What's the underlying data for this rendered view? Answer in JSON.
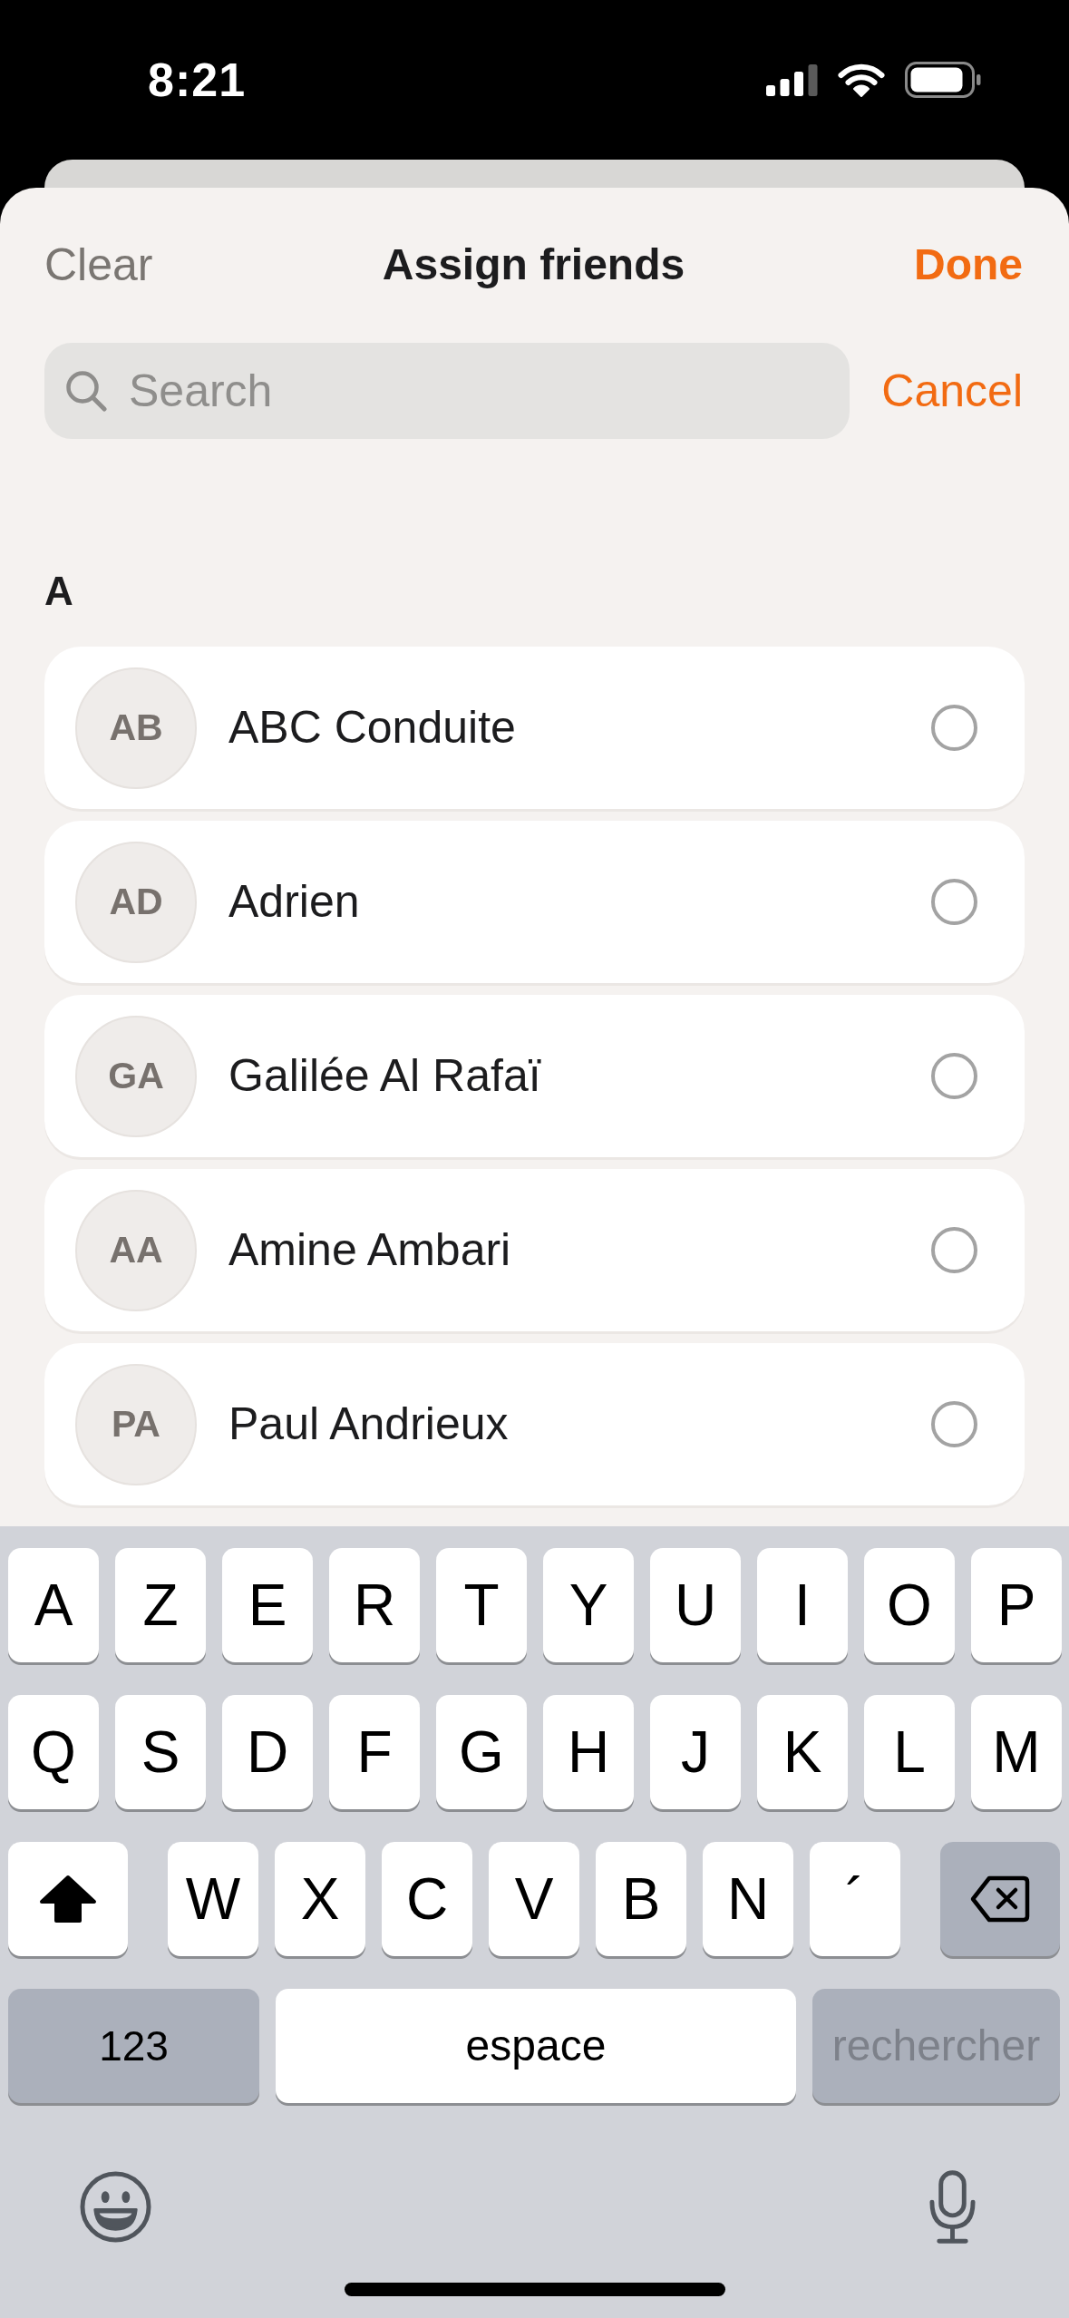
{
  "status_bar": {
    "time": "8:21"
  },
  "header": {
    "clear": "Clear",
    "title": "Assign friends",
    "done": "Done"
  },
  "search": {
    "placeholder": "Search",
    "cancel": "Cancel"
  },
  "sections": [
    {
      "letter": "A",
      "friends": [
        {
          "initials": "AB",
          "name": "ABC Conduite",
          "selected": false
        },
        {
          "initials": "AD",
          "name": "Adrien",
          "selected": false
        },
        {
          "initials": "GA",
          "name": "Galilée Al Rafaï",
          "selected": false
        },
        {
          "initials": "AA",
          "name": "Amine Ambari",
          "selected": false
        },
        {
          "initials": "PA",
          "name": "Paul Andrieux",
          "selected": false
        }
      ]
    }
  ],
  "keyboard": {
    "rows": [
      [
        "A",
        "Z",
        "E",
        "R",
        "T",
        "Y",
        "U",
        "I",
        "O",
        "P"
      ],
      [
        "Q",
        "S",
        "D",
        "F",
        "G",
        "H",
        "J",
        "K",
        "L",
        "M"
      ],
      [
        "W",
        "X",
        "C",
        "V",
        "B",
        "N",
        "´"
      ]
    ],
    "shift_on": true,
    "numbers_key": "123",
    "space_key": "espace",
    "search_key": {
      "label": "rechercher",
      "disabled": true
    }
  }
}
